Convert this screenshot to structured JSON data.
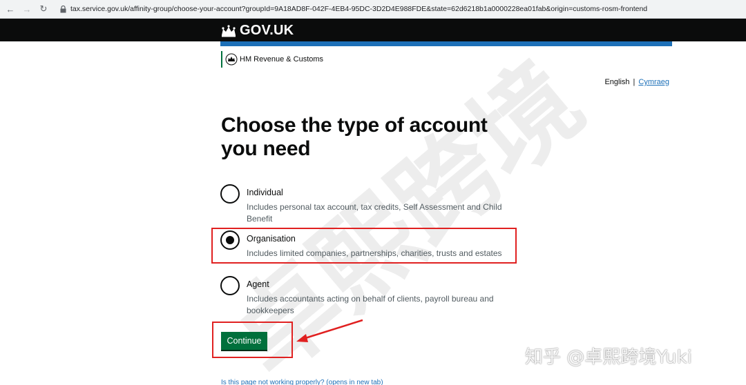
{
  "browser": {
    "url": "tax.service.gov.uk/affinity-group/choose-your-account?groupId=9A18AD8F-042F-4EB4-95DC-3D2D4E988FDE&state=62d6218b1a0000228ea01fab&origin=customs-rosm-frontend"
  },
  "header": {
    "logo_text": "GOV.UK",
    "department": "HM Revenue & Customs"
  },
  "language": {
    "current": "English",
    "separator": "|",
    "alternate": "Cymraeg"
  },
  "page_title": "Choose the type of account you need",
  "options": [
    {
      "label": "Individual",
      "hint": "Includes personal tax account, tax credits, Self Assessment and Child Benefit",
      "checked": false
    },
    {
      "label": "Organisation",
      "hint": "Includes limited companies, partnerships, charities, trusts and estates",
      "checked": true
    },
    {
      "label": "Agent",
      "hint": "Includes accountants acting on behalf of clients, payroll bureau and bookkeepers",
      "checked": false
    }
  ],
  "continue_label": "Continue",
  "footer_link": "Is this page not working properly? (opens in new tab)",
  "watermarks": {
    "diagonal": "卓熙跨境",
    "corner": "知乎 @卓熙跨境Yuki"
  },
  "colors": {
    "gov_black": "#0b0c0c",
    "gov_blue": "#1d70b8",
    "button_green": "#00703c",
    "annotation_red": "#e02020"
  }
}
